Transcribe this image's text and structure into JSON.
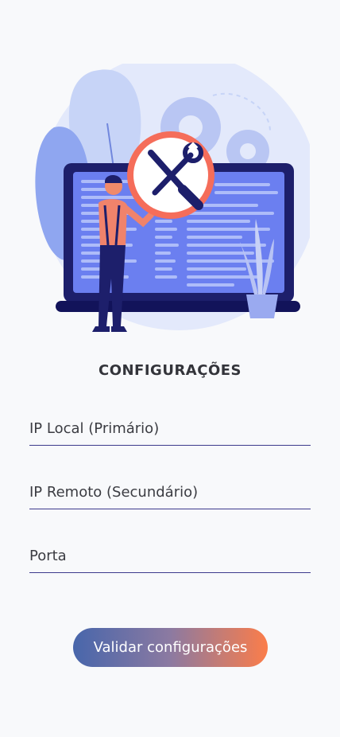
{
  "screen": {
    "title": "CONFIGURAÇÕES"
  },
  "form": {
    "ip_local": {
      "placeholder": "IP Local (Primário)",
      "value": ""
    },
    "ip_remote": {
      "placeholder": "IP Remoto (Secundário)",
      "value": ""
    },
    "port": {
      "placeholder": "Porta",
      "value": ""
    }
  },
  "actions": {
    "submit_label": "Validar configurações"
  },
  "illustration": {
    "icon": "settings-tools-icon"
  },
  "colors": {
    "background": "#f8f9fb",
    "underline": "#3d3a8c",
    "gradient_start": "#4866ab",
    "gradient_end": "#fb7d4a",
    "title": "#33343a"
  }
}
